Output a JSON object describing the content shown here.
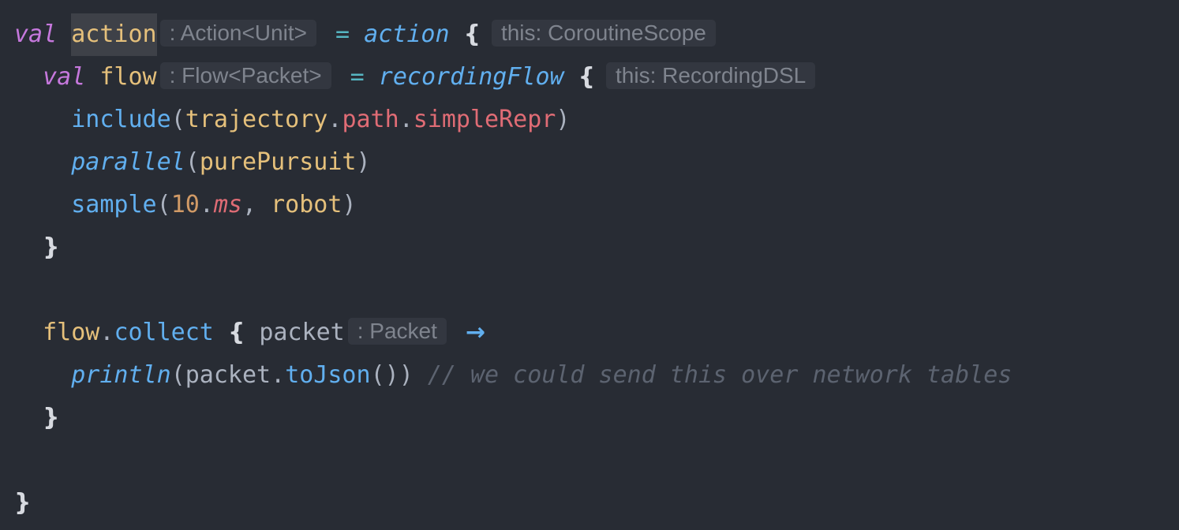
{
  "editor": {
    "background": "#282c34",
    "colors": {
      "keyword": "#c678dd",
      "variable": "#e5c07b",
      "function": "#61afef",
      "property": "#e06c75",
      "number": "#d19a66",
      "comment": "#5c6370",
      "hint_text": "#7f848e",
      "hint_bg": "#333740"
    },
    "lines": {
      "l1": {
        "keyword": "val",
        "name": "action",
        "type_hint": ": Action<Unit>",
        "equals": "=",
        "call": "action",
        "brace": "{",
        "receiver_hint": "this: CoroutineScope"
      },
      "l2": {
        "keyword": "val",
        "name": "flow",
        "type_hint": ": Flow<Packet>",
        "equals": "=",
        "call": "recordingFlow",
        "brace": "{",
        "receiver_hint": "this: RecordingDSL"
      },
      "l3": {
        "call": "include",
        "open": "(",
        "arg": "trajectory",
        "dot1": ".",
        "prop1": "path",
        "dot2": ".",
        "prop2": "simpleRepr",
        "close": ")"
      },
      "l4": {
        "call": "parallel",
        "open": "(",
        "arg": "purePursuit",
        "close": ")"
      },
      "l5": {
        "call": "sample",
        "open": "(",
        "number": "10",
        "dot": ".",
        "unit": "ms",
        "comma": ", ",
        "arg": "robot",
        "close": ")"
      },
      "l6": {
        "brace": "}"
      },
      "l8": {
        "receiver": "flow",
        "dot": ".",
        "call": "collect",
        "brace": "{",
        "param": "packet",
        "type_hint": ": Packet",
        "arrow": "→"
      },
      "l9": {
        "call": "println",
        "open": "(",
        "arg": "packet",
        "dot": ".",
        "method": "toJson",
        "parens": "()",
        "close": ")",
        "comment": "// we could send this over network tables"
      },
      "l10": {
        "brace": "}"
      },
      "l12": {
        "brace": "}"
      }
    }
  }
}
